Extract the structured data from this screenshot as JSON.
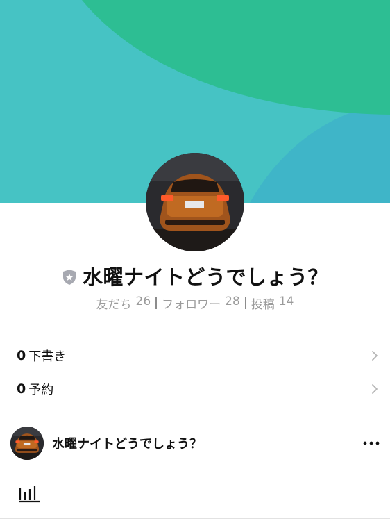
{
  "profile": {
    "name": "水曜ナイトどうでしょう？",
    "badge_icon": "shield-star-icon"
  },
  "stats": [
    {
      "label": "友だち",
      "value": "26"
    },
    {
      "label": "フォロワー",
      "value": "28"
    },
    {
      "label": "投稿",
      "value": "14"
    }
  ],
  "drafts": {
    "count": "0",
    "label": "下書き"
  },
  "scheduled": {
    "count": "0",
    "label": "予約"
  },
  "post_author": {
    "name": "水曜ナイトどうでしょう？"
  },
  "icons": {
    "more": "more-dots-icon",
    "chevron": "chevron-right-icon",
    "insights": "bar-chart-icon"
  },
  "colors": {
    "cover_teal": "#46c3c4",
    "cover_green": "#2dbe93",
    "cover_blue": "#3fb5c8"
  }
}
